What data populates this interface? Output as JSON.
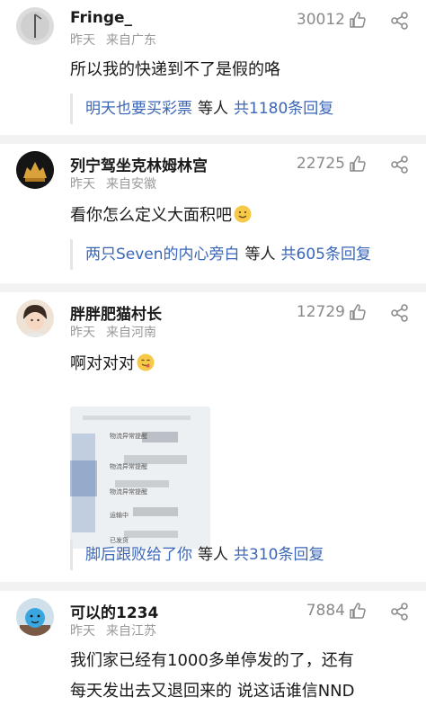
{
  "comments": [
    {
      "username": "Fringe_",
      "time": "昨天",
      "location": "来自广东",
      "likes": "30012",
      "text": "所以我的快递到不了是假的咯",
      "reply": {
        "name": "明天也要买彩票",
        "mid": "等人",
        "total": "共1180条回复"
      }
    },
    {
      "username": "列宁驾坐克林姆林宫",
      "time": "昨天",
      "location": "来自安徽",
      "likes": "22725",
      "text": "看你怎么定义大面积吧",
      "reply": {
        "name": "两只Seven的内心旁白",
        "mid": "等人",
        "total": "共605条回复"
      }
    },
    {
      "username": "胖胖肥猫村长",
      "time": "昨天",
      "location": "来自河南",
      "likes": "12729",
      "text": "啊对对对",
      "image_lines": [
        "物流异常提醒",
        "物流异常提醒",
        "物流异常提醒",
        "运输中",
        "已发货"
      ],
      "reply": {
        "name": "脚后跟败给了你",
        "mid": "等人",
        "total": "共310条回复"
      }
    },
    {
      "username": "可以的1234",
      "time": "昨天",
      "location": "来自江苏",
      "likes": "7884",
      "text_line1": "我们家已经有1000多单停发的了，还有",
      "text_line2": "每天发出去又退回来的 说这话谁信NND"
    }
  ],
  "colors": {
    "link": "#3a66b8",
    "meta": "#9a9a9a",
    "divider": "#f2f2f2"
  },
  "icons": [
    "thumb-up-icon",
    "share-icon",
    "smile-emoji-icon",
    "yummy-emoji-icon"
  ]
}
